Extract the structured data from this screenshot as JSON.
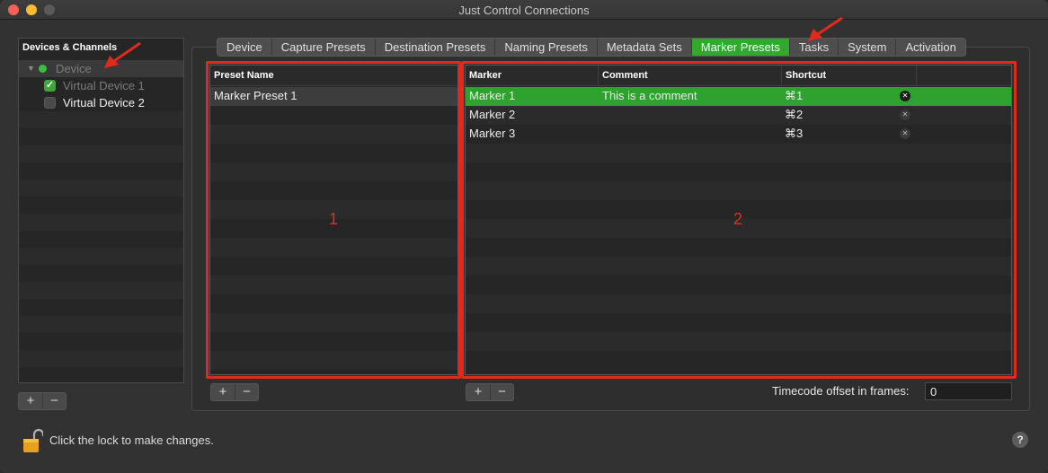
{
  "window": {
    "title": "Just Control Connections"
  },
  "sidebar": {
    "header": "Devices & Channels",
    "device": {
      "label": "Device"
    },
    "channels": [
      {
        "label": "Virtual Device 1",
        "checked": true
      },
      {
        "label": "Virtual Device 2",
        "checked": false
      }
    ],
    "add_label": "+",
    "remove_label": "−"
  },
  "tabs": [
    {
      "label": "Device",
      "active": false
    },
    {
      "label": "Capture Presets",
      "active": false
    },
    {
      "label": "Destination Presets",
      "active": false
    },
    {
      "label": "Naming Presets",
      "active": false
    },
    {
      "label": "Metadata Sets",
      "active": false
    },
    {
      "label": "Marker Presets",
      "active": true
    },
    {
      "label": "Tasks",
      "active": false
    },
    {
      "label": "System",
      "active": false
    },
    {
      "label": "Activation",
      "active": false
    }
  ],
  "presets_table": {
    "header": "Preset Name",
    "rows": [
      "Marker Preset 1"
    ],
    "add_label": "+",
    "remove_label": "−"
  },
  "markers_table": {
    "columns": {
      "marker": "Marker",
      "comment": "Comment",
      "shortcut": "Shortcut"
    },
    "rows": [
      {
        "marker": "Marker 1",
        "comment": "This is a comment",
        "shortcut": "⌘1"
      },
      {
        "marker": "Marker 2",
        "comment": "",
        "shortcut": "⌘2"
      },
      {
        "marker": "Marker 3",
        "comment": "",
        "shortcut": "⌘3"
      }
    ],
    "add_label": "+",
    "remove_label": "−"
  },
  "annotations": {
    "label_1": "1",
    "label_2": "2"
  },
  "timecode": {
    "label": "Timecode offset in frames:",
    "value": "0"
  },
  "footer": {
    "lock_text": "Click the lock to make changes.",
    "help_label": "?"
  },
  "colors": {
    "accent": "#2faa2f",
    "annotation_red": "#e02a1d"
  }
}
